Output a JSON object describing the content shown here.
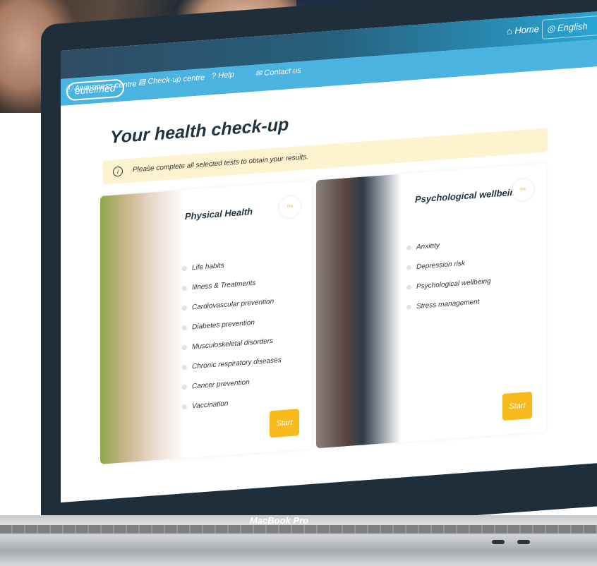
{
  "topbar": {
    "home": "Home",
    "language": "English"
  },
  "nav": {
    "logo": "eutelmed",
    "items": [
      {
        "label": "Awareness centre",
        "icon": "info-icon"
      },
      {
        "label": "Check-up centre",
        "icon": "clipboard-icon"
      },
      {
        "label": "Help",
        "icon": "help-icon"
      },
      {
        "label": "Contact us",
        "icon": "mail-icon"
      }
    ]
  },
  "main": {
    "title": "Your health check-up",
    "notice": "Please complete all selected tests to obtain your results."
  },
  "cards": [
    {
      "title": "Physical Health",
      "progress": "0%",
      "items": [
        "Life habits",
        "Illness & Treatments",
        "Cardiovascular prevention",
        "Diabetes prevention",
        "Musculoskeletal disorders",
        "Chronic respiratory diseases",
        "Cancer prevention",
        "Vaccination"
      ],
      "button": "Start"
    },
    {
      "title": "Psychological wellbeing",
      "progress": "0%",
      "items": [
        "Anxiety",
        "Depression risk",
        "Psychological wellbeing",
        "Stress management"
      ],
      "button": "Start"
    }
  ],
  "device": {
    "brand": "MacBook Pro"
  },
  "colors": {
    "accent": "#4ab3e0",
    "button": "#f7b91c",
    "notice": "#fdf3cf"
  }
}
